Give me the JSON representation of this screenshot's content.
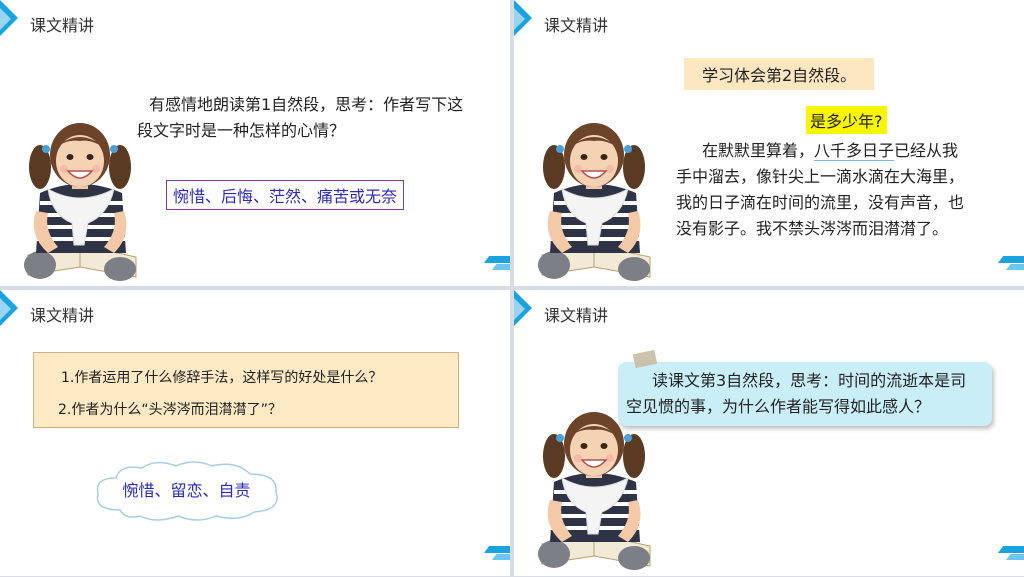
{
  "section_title": "课文精讲",
  "slide1": {
    "prompt_line1": "有感情地朗读第1自然段，思考：作者写下这",
    "prompt_line2": "段文字时是一种怎样的心情？",
    "answer": "惋惜、后悔、茫然、痛苦或无奈"
  },
  "slide2": {
    "heading": "学习体会第2自然段。",
    "question": "是多少年?",
    "line1_a": "在默默里算着，",
    "line1_b": "八千多日子",
    "line1_c": "已经从我",
    "line2": "手中溜去，像针尖上一滴水滴在大海里，",
    "line3": "我的日子滴在时间的流里，没有声音，也",
    "line4": "没有影子。我不禁头涔涔而泪潸潸了。"
  },
  "slide3": {
    "q1": "1.作者运用了什么修辞手法，这样写的好处是什么？",
    "q2": "2.作者为什么“头涔涔而泪潸潸了”？",
    "answer": "惋惜、留恋、自责"
  },
  "slide4": {
    "prompt_line1": "读课文第3自然段，思考：时间的流逝本是司",
    "prompt_line2": "空见惯的事，为什么作者能写得如此感人？"
  },
  "colors": {
    "accent": "#1aa3df",
    "answer_text": "#2b2bb8",
    "answer_border": "#7b3f9b",
    "highlight_yellow": "#f7f500",
    "highlight_peach": "#fde7c0",
    "note_blue": "#c9eef8"
  },
  "icons": [
    "blue-triangle-icon",
    "corner-stripes-icon",
    "girl-reading-illustration",
    "cloud-shape"
  ]
}
